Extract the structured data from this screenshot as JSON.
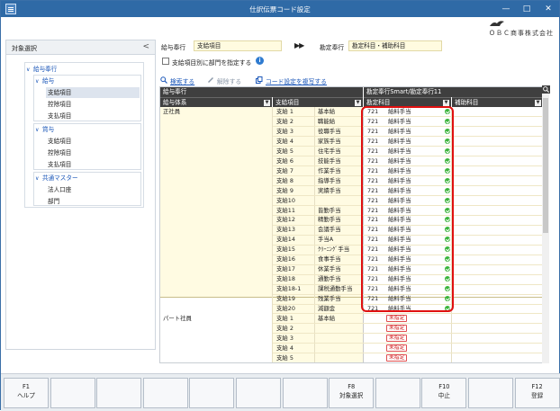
{
  "window": {
    "title": "仕訳伝票コード設定",
    "company": "ＯＢＣ商事株式会社"
  },
  "left_pane": {
    "title": "対象選択",
    "tree": [
      {
        "label": "給与奉行",
        "level": 0
      },
      {
        "label": "給与",
        "level": 1
      },
      {
        "label": "支給項目",
        "level": 2,
        "selected": true
      },
      {
        "label": "控除項目",
        "level": 2
      },
      {
        "label": "支払項目",
        "level": 2
      },
      {
        "label": "賞与",
        "level": 1
      },
      {
        "label": "支給項目",
        "level": 2
      },
      {
        "label": "控除項目",
        "level": 2
      },
      {
        "label": "支払項目",
        "level": 2
      },
      {
        "label": "共通マスター",
        "level": 1
      },
      {
        "label": "法人口座",
        "level": 2
      },
      {
        "label": "部門",
        "level": 2
      }
    ]
  },
  "top": {
    "left_label": "給与奉行",
    "left_value": "支給項目",
    "arrow": "▶▶",
    "right_label": "勘定奉行",
    "right_value": "勘定科目・補助科目",
    "dept_checkbox": "支給項目別に部門を指定する"
  },
  "toolbar": {
    "search": "検索する",
    "unset": "解除する",
    "copy": "コード設定を複写する"
  },
  "grid": {
    "group_left": "給与奉行",
    "group_right": "勘定奉行Smart/勘定奉行11",
    "cols": {
      "kyuyo_taikei": "給与体系",
      "shikyu_koumoku": "支給項目",
      "kanjo": "勘定科目",
      "hojo": "補助科目"
    },
    "rows": [
      {
        "taikei": "正社員",
        "code": "支給 1",
        "name": "基本給",
        "acct_code": "721",
        "acct_name": "給料手当",
        "status": "ok"
      },
      {
        "taikei": "",
        "code": "支給 2",
        "name": "職能給",
        "acct_code": "721",
        "acct_name": "給料手当",
        "status": "ok"
      },
      {
        "taikei": "",
        "code": "支給 3",
        "name": "役職手当",
        "acct_code": "721",
        "acct_name": "給料手当",
        "status": "ok"
      },
      {
        "taikei": "",
        "code": "支給 4",
        "name": "家族手当",
        "acct_code": "721",
        "acct_name": "給料手当",
        "status": "ok"
      },
      {
        "taikei": "",
        "code": "支給 5",
        "name": "住宅手当",
        "acct_code": "721",
        "acct_name": "給料手当",
        "status": "ok"
      },
      {
        "taikei": "",
        "code": "支給 6",
        "name": "技能手当",
        "acct_code": "721",
        "acct_name": "給料手当",
        "status": "ok"
      },
      {
        "taikei": "",
        "code": "支給 7",
        "name": "作業手当",
        "acct_code": "721",
        "acct_name": "給料手当",
        "status": "ok"
      },
      {
        "taikei": "",
        "code": "支給 8",
        "name": "指導手当",
        "acct_code": "721",
        "acct_name": "給料手当",
        "status": "ok"
      },
      {
        "taikei": "",
        "code": "支給 9",
        "name": "実績手当",
        "acct_code": "721",
        "acct_name": "給料手当",
        "status": "ok"
      },
      {
        "taikei": "",
        "code": "支給10",
        "name": "",
        "acct_code": "721",
        "acct_name": "給料手当",
        "status": "ok"
      },
      {
        "taikei": "",
        "code": "支給11",
        "name": "皆勤手当",
        "acct_code": "721",
        "acct_name": "給料手当",
        "status": "ok"
      },
      {
        "taikei": "",
        "code": "支給12",
        "name": "精勤手当",
        "acct_code": "721",
        "acct_name": "給料手当",
        "status": "ok"
      },
      {
        "taikei": "",
        "code": "支給13",
        "name": "会議手当",
        "acct_code": "721",
        "acct_name": "給料手当",
        "status": "ok"
      },
      {
        "taikei": "",
        "code": "支給14",
        "name": "手当A",
        "acct_code": "721",
        "acct_name": "給料手当",
        "status": "ok"
      },
      {
        "taikei": "",
        "code": "支給15",
        "name": "ｸﾘｰﾆﾝｸﾞ手当",
        "acct_code": "721",
        "acct_name": "給料手当",
        "status": "ok"
      },
      {
        "taikei": "",
        "code": "支給16",
        "name": "食事手当",
        "acct_code": "721",
        "acct_name": "給料手当",
        "status": "ok"
      },
      {
        "taikei": "",
        "code": "支給17",
        "name": "休業手当",
        "acct_code": "721",
        "acct_name": "給料手当",
        "status": "ok"
      },
      {
        "taikei": "",
        "code": "支給18",
        "name": "通勤手当",
        "acct_code": "721",
        "acct_name": "給料手当",
        "status": "ok"
      },
      {
        "taikei": "",
        "code": "支給18-1",
        "name": "課税通勤手当",
        "acct_code": "721",
        "acct_name": "給料手当",
        "status": "ok"
      },
      {
        "taikei": "",
        "code": "支給19",
        "name": "残業手当",
        "acct_code": "721",
        "acct_name": "給料手当",
        "status": "ok"
      },
      {
        "taikei": "",
        "code": "支給20",
        "name": "減額金",
        "acct_code": "721",
        "acct_name": "給料手当",
        "status": "ok"
      },
      {
        "taikei": "パート社員",
        "code": "支給 1",
        "name": "基本給",
        "acct_code": "",
        "acct_name": "未指定",
        "status": "unset"
      },
      {
        "taikei": "",
        "code": "支給 2",
        "name": "",
        "acct_code": "",
        "acct_name": "未指定",
        "status": "unset"
      },
      {
        "taikei": "",
        "code": "支給 3",
        "name": "",
        "acct_code": "",
        "acct_name": "未指定",
        "status": "unset"
      },
      {
        "taikei": "",
        "code": "支給 4",
        "name": "",
        "acct_code": "",
        "acct_name": "未指定",
        "status": "unset"
      },
      {
        "taikei": "",
        "code": "支給 5",
        "name": "",
        "acct_code": "",
        "acct_name": "未指定",
        "status": "unset"
      }
    ]
  },
  "fkeys": [
    {
      "key": "F1",
      "label": "ヘルプ"
    },
    {
      "key": "",
      "label": ""
    },
    {
      "key": "",
      "label": ""
    },
    {
      "key": "",
      "label": ""
    },
    {
      "key": "",
      "label": ""
    },
    {
      "key": "",
      "label": ""
    },
    {
      "key": "",
      "label": ""
    },
    {
      "key": "F8",
      "label": "対象選択"
    },
    {
      "key": "",
      "label": ""
    },
    {
      "key": "F10",
      "label": "中止"
    },
    {
      "key": "",
      "label": ""
    },
    {
      "key": "F12",
      "label": "登録"
    }
  ]
}
